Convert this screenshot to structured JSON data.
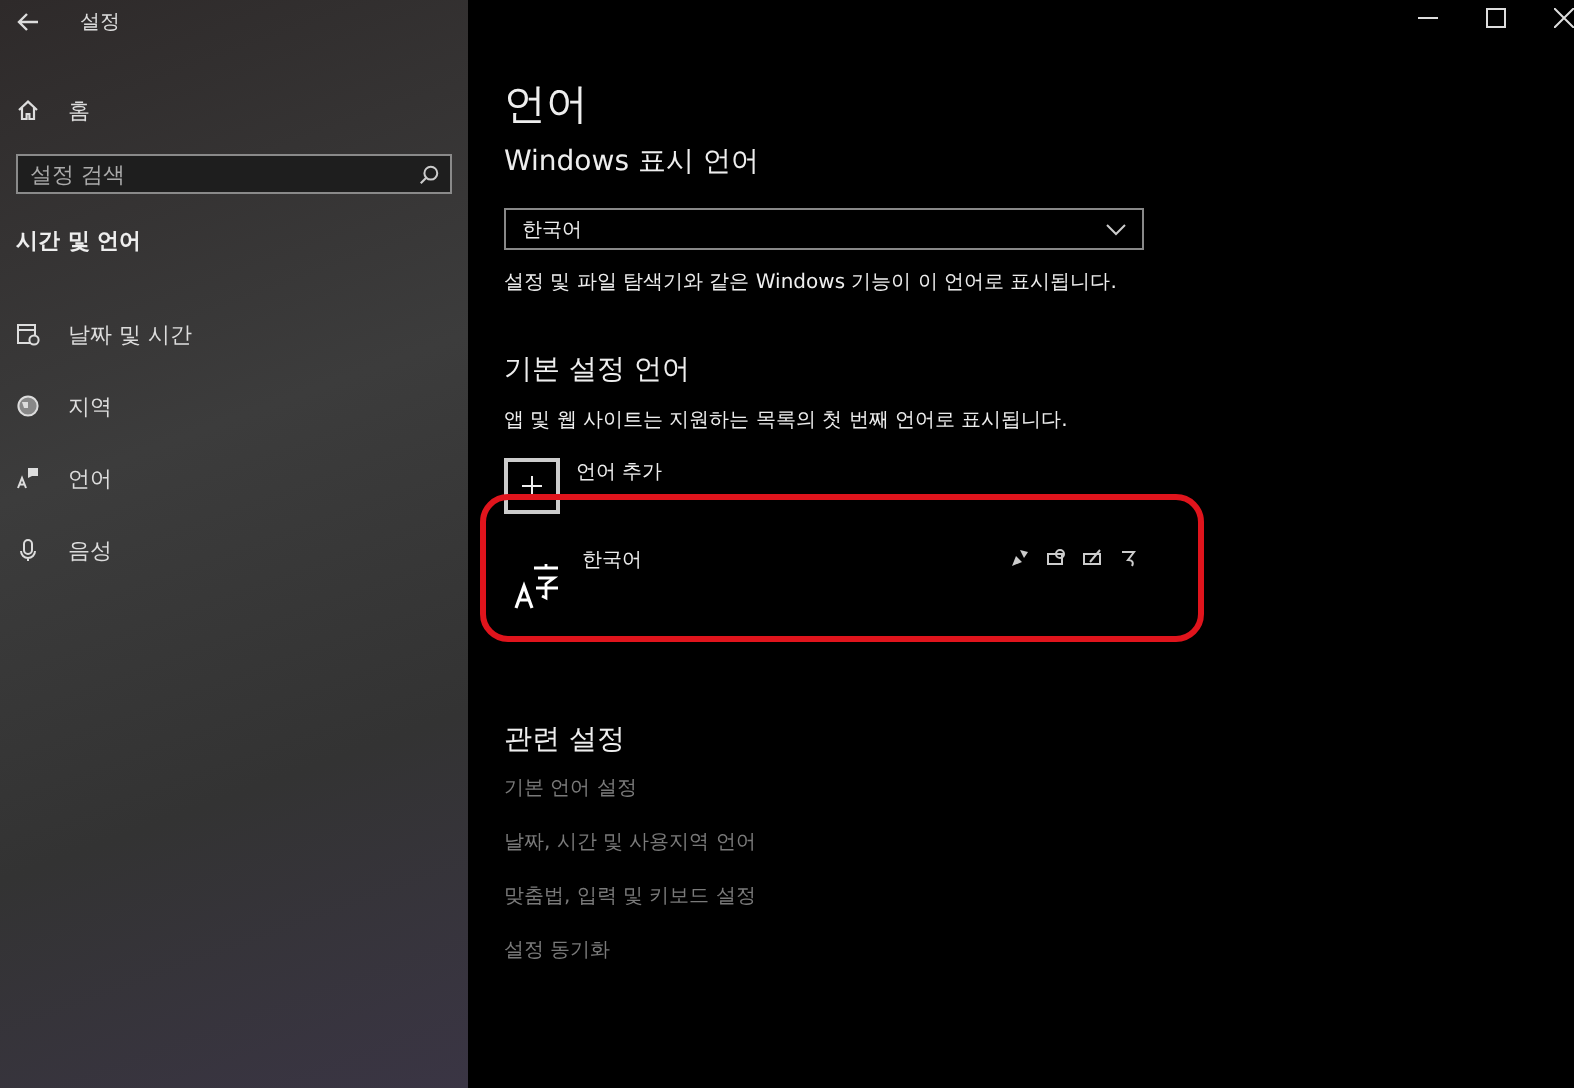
{
  "window": {
    "title": "설정"
  },
  "sidebar": {
    "home": "홈",
    "search": {
      "placeholder": "설정 검색"
    },
    "section_title": "시간 및 언어",
    "items": [
      "날짜 및 시간",
      "지역",
      "언어",
      "음성"
    ]
  },
  "page": {
    "title": "언어",
    "display_language": {
      "heading": "Windows 표시 언어",
      "value": "한국어",
      "note": "설정 및 파일 탐색기와 같은 Windows 기능이 이 언어로 표시됩니다."
    },
    "preferred": {
      "heading": "기본 설정 언어",
      "note": "앱 및 웹 사이트는 지원하는 목록의 첫 번째 언어로 표시됩니다.",
      "add_label": "언어 추가",
      "languages": [
        {
          "name": "한국어",
          "highlighted": true
        }
      ]
    },
    "related": {
      "heading": "관련 설정",
      "links": [
        "기본 언어 설정",
        "날짜, 시간 및 사용지역 언어",
        "맞춤법, 입력 및 키보드 설정",
        "설정 동기화"
      ]
    }
  }
}
